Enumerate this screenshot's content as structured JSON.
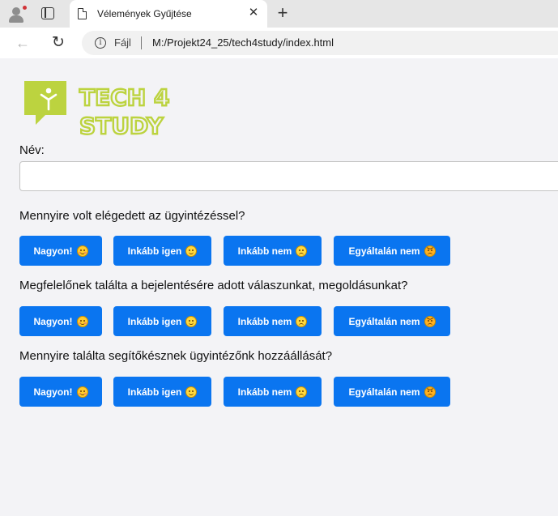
{
  "browser": {
    "tab_title": "Vélemények Gyűjtése",
    "tab_close": "✕",
    "new_tab": "+",
    "address_scheme": "Fájl",
    "address_url": "M:/Projekt24_25/tech4study/index.html",
    "info_glyph": "i",
    "back_glyph": "←",
    "reload_glyph": "↻"
  },
  "logo": {
    "line1": "TECH 4",
    "line2": "STUDY",
    "color": "#bcd33f"
  },
  "form": {
    "name_label": "Név:",
    "name_value": "",
    "questions": [
      {
        "text": "Mennyire volt elégedett az ügyintézéssel?",
        "options": [
          "Nagyon!",
          "Inkább igen",
          "Inkább nem",
          "Egyáltalán nem"
        ]
      },
      {
        "text": "Megfelelőnek találta a bejelentésére adott válaszunkat, megoldásunkat?",
        "options": [
          "Nagyon!",
          "Inkább igen",
          "Inkább nem",
          "Egyáltalán nem"
        ]
      },
      {
        "text": "Mennyire találta segítőkésznek ügyintézőnk hozzáállását?",
        "options": [
          "Nagyon!",
          "Inkább igen",
          "Inkább nem",
          "Egyáltalán nem"
        ]
      }
    ],
    "button_color": "#0a75f0",
    "option_icons": [
      "smiling-blush-emoji-icon",
      "slight-smile-emoji-icon",
      "slight-frown-emoji-icon",
      "angry-emoji-icon"
    ]
  }
}
